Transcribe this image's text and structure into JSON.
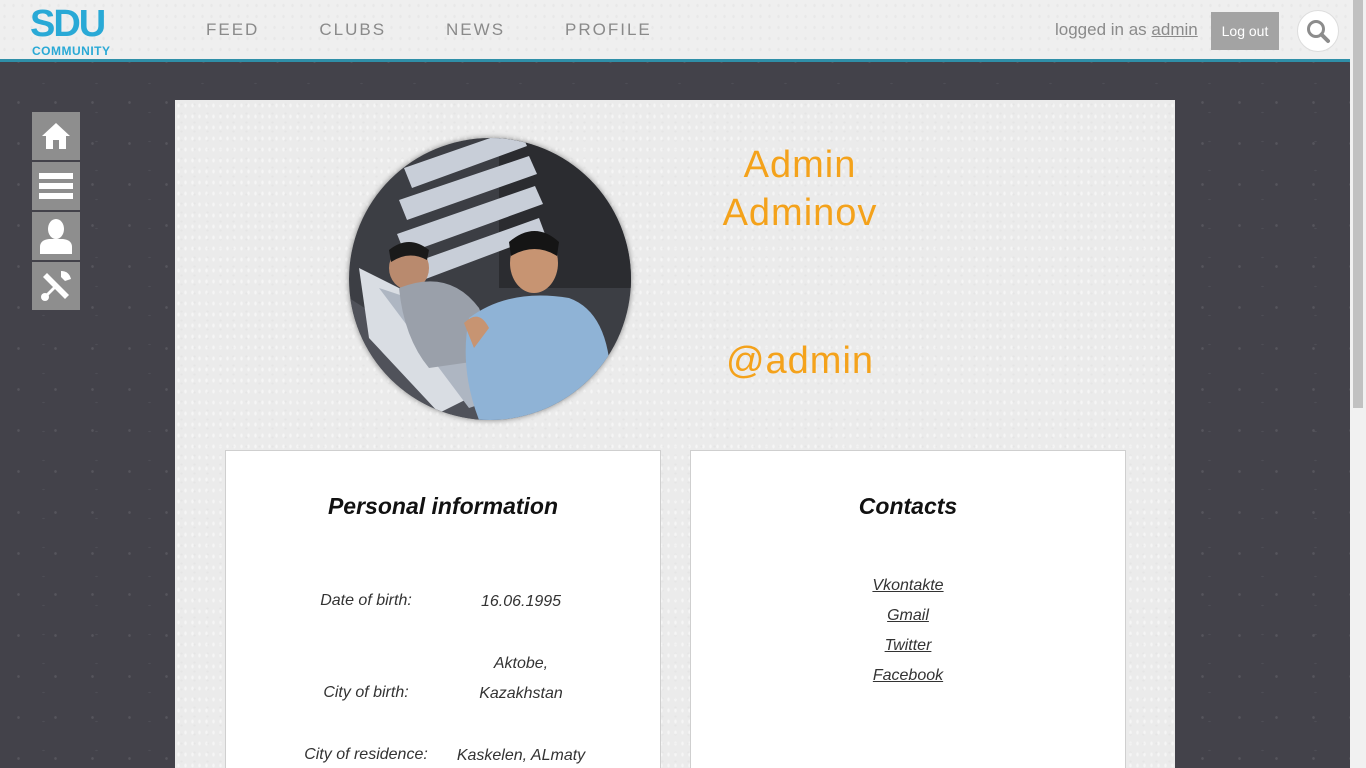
{
  "header": {
    "logo_mark": "SDU",
    "logo_sub": "COMMUNITY",
    "nav": [
      "FEED",
      "CLUBS",
      "NEWS",
      "PROFILE"
    ],
    "login_prefix": "logged in as ",
    "login_user": "admin",
    "logout_label": "Log out",
    "search_icon": "search-icon"
  },
  "sidebar": {
    "icons": [
      "home-icon",
      "menu-icon",
      "user-icon",
      "tools-icon"
    ]
  },
  "profile": {
    "first_name": "Admin",
    "last_name": "Adminov",
    "handle": "@admin"
  },
  "personal_info": {
    "title": "Personal information",
    "rows": [
      {
        "label": "Date of birth:",
        "value": "16.06.1995"
      },
      {
        "label": "City of birth:",
        "value_line1": "Aktobe,",
        "value_line2": "Kazakhstan"
      },
      {
        "label": "City of residence:",
        "value": "Kaskelen, ALmaty"
      }
    ]
  },
  "contacts": {
    "title": "Contacts",
    "links": [
      "Vkontakte",
      "Gmail",
      "Twitter",
      "Facebook"
    ]
  },
  "colors": {
    "accent_orange": "#f4a21b",
    "brand_blue": "#29a9d6",
    "background_dark": "#43424a"
  }
}
